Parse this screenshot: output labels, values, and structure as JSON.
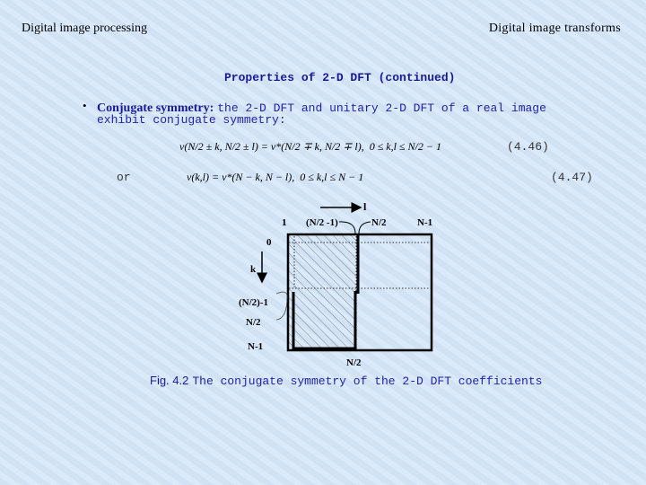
{
  "header": {
    "left": "Digital image processing",
    "right": "Digital image transforms"
  },
  "title": "Properties of 2-D DFT (continued)",
  "bullet": {
    "term": "Conjugate symmetry:",
    "text_line1": "the 2-D DFT and unitary 2-D DFT of a real image",
    "text_line2": "exhibit conjugate symmetry:"
  },
  "eq1": {
    "lhs": "v(N/2 ± k, N/2 ± l) = v*(N/2 ∓ k, N/2 ∓ l),",
    "cond": "0 ≤ k,l ≤ N/2 − 1",
    "number": "(4.46)"
  },
  "eq2": {
    "or": "or",
    "lhs": "v(k,l) = v*(N − k, N − l),",
    "cond": "0 ≤ k,l ≤ N − 1",
    "number": "(4.47)"
  },
  "figure": {
    "l_axis": "l",
    "k_axis": "k",
    "top_1": "1",
    "top_n2m1": "(N/2 -1)",
    "top_n2": "N/2",
    "top_nm1": "N-1",
    "left_0": "0",
    "left_n2m1": "(N/2)-1",
    "left_n2": "N/2",
    "left_nm1": "N-1",
    "bottom_n2": "N/2"
  },
  "caption": {
    "label": "Fig. 4.2",
    "text": "The conjugate symmetry of the 2-D DFT coefficients"
  }
}
